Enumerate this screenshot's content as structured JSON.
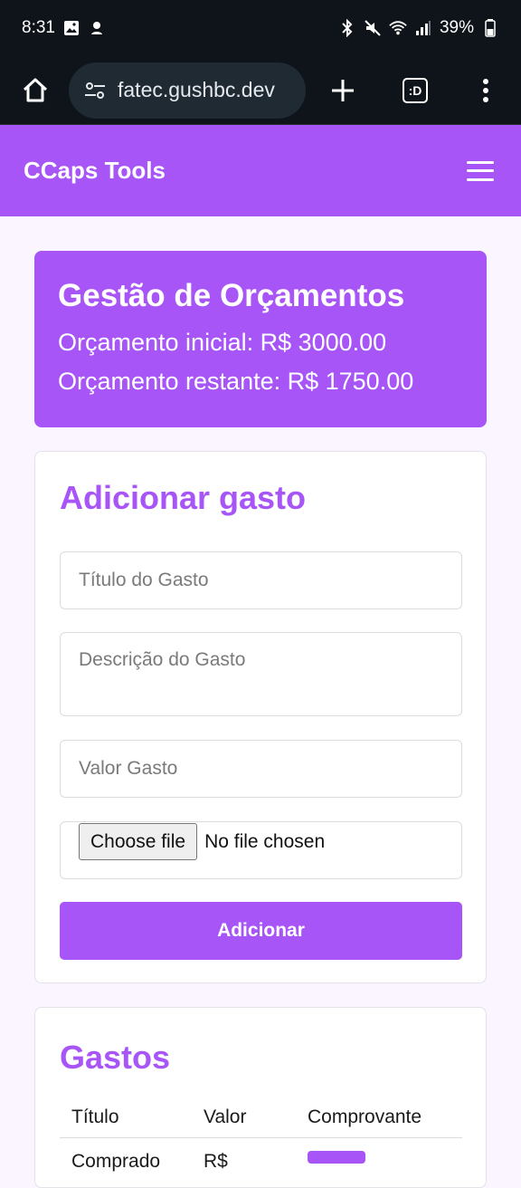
{
  "status_bar": {
    "time": "8:31",
    "battery": "39%"
  },
  "browser": {
    "url": "fatec.gushbc.dev",
    "tabs_label": ":D"
  },
  "app": {
    "title": "CCaps Tools"
  },
  "budget": {
    "title": "Gestão de Orçamentos",
    "initial": "Orçamento inicial: R$ 3000.00",
    "remaining": "Orçamento restante: R$ 1750.00"
  },
  "form": {
    "title": "Adicionar gasto",
    "title_placeholder": "Título do Gasto",
    "description_placeholder": "Descrição do Gasto",
    "value_placeholder": "Valor Gasto",
    "file_button": "Choose file",
    "file_status": "No file chosen",
    "submit_label": "Adicionar"
  },
  "expenses": {
    "title": "Gastos",
    "columns": [
      "Título",
      "Valor",
      "Comprovante"
    ],
    "rows": [
      {
        "title": "Comprado",
        "value": "R$"
      }
    ]
  },
  "colors": {
    "accent": "#a855f7",
    "background": "#faf5ff",
    "statusbar": "#0f141a"
  }
}
